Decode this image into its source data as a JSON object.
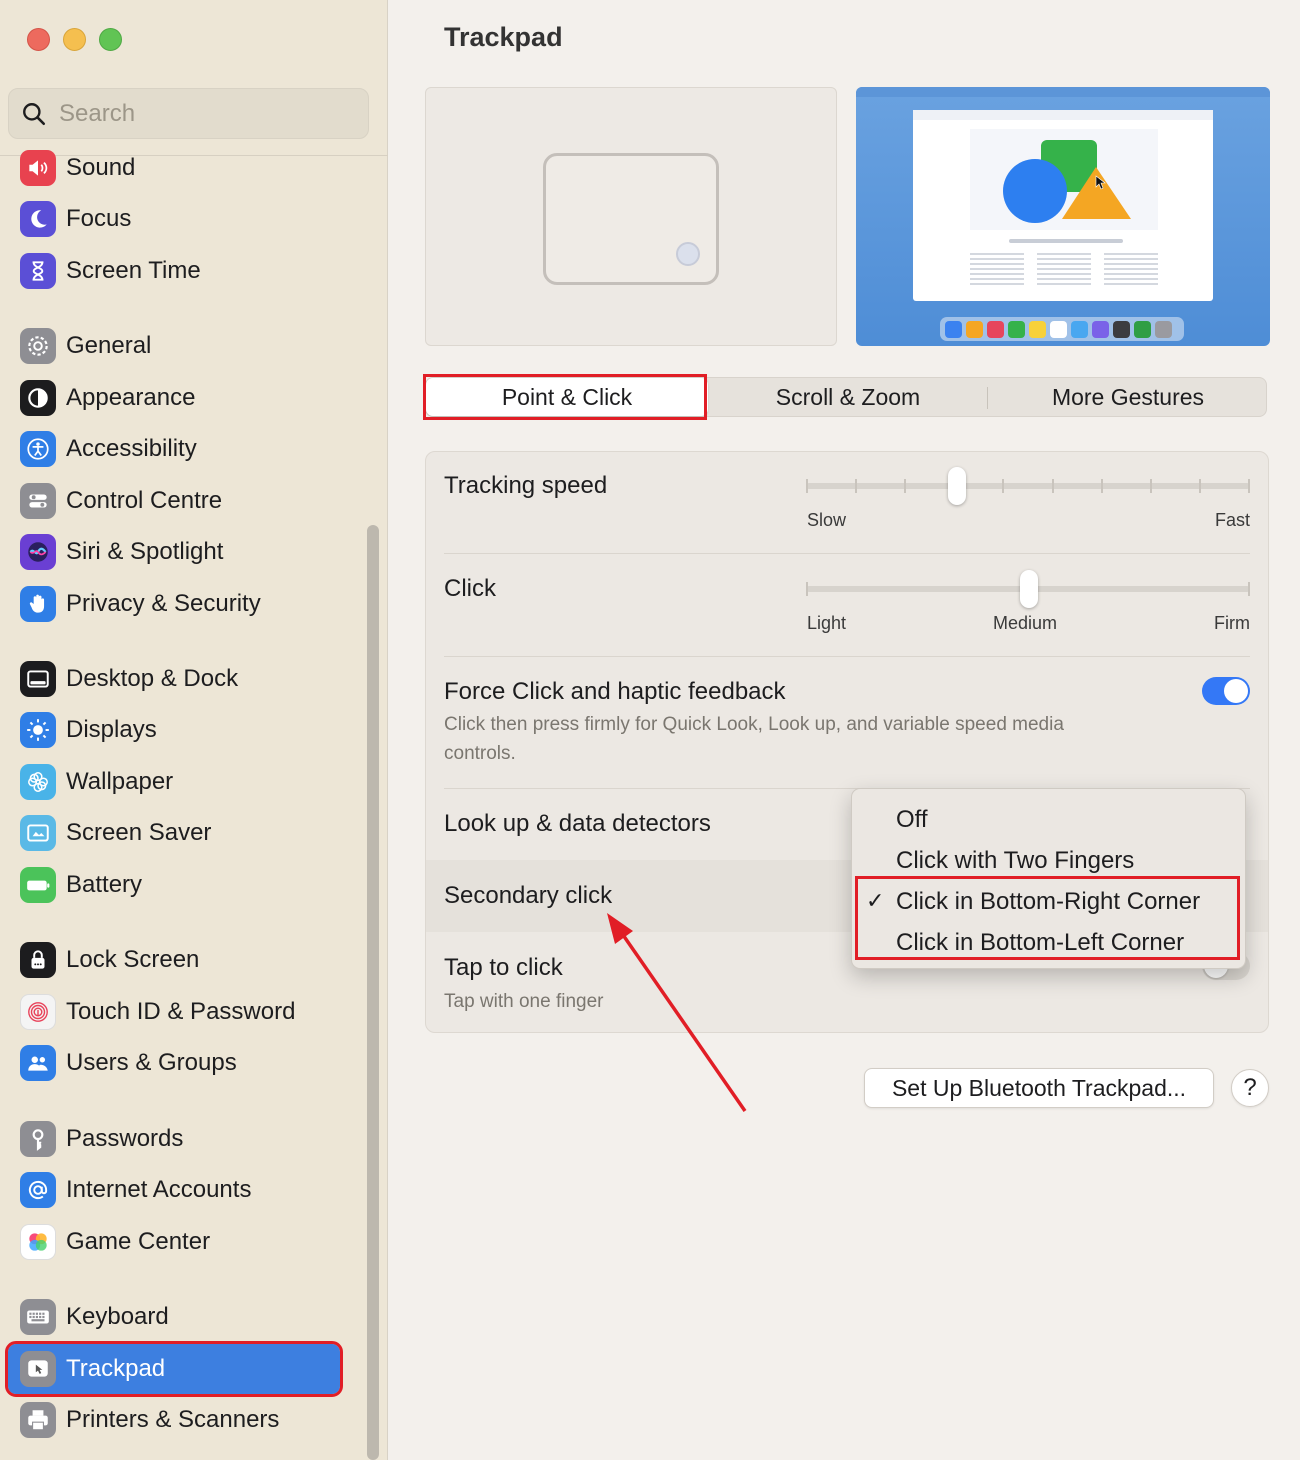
{
  "search": {
    "placeholder": "Search"
  },
  "sidebar": {
    "items": [
      {
        "label": "Sound",
        "icon": "sound-icon",
        "color": "#e8424f"
      },
      {
        "label": "Focus",
        "icon": "moon-icon",
        "color": "#5b4fd6"
      },
      {
        "label": "Screen Time",
        "icon": "hourglass-icon",
        "color": "#5b4fd6"
      },
      {
        "label": "General",
        "icon": "gear-icon",
        "color": "#8e8e93"
      },
      {
        "label": "Appearance",
        "icon": "appearance-icon",
        "color": "#1c1c1e"
      },
      {
        "label": "Accessibility",
        "icon": "accessibility-icon",
        "color": "#2f7ee6"
      },
      {
        "label": "Control Centre",
        "icon": "control-centre-icon",
        "color": "#8e8e93"
      },
      {
        "label": "Siri & Spotlight",
        "icon": "siri-icon",
        "color": "#6a3fd3"
      },
      {
        "label": "Privacy & Security",
        "icon": "hand-icon",
        "color": "#2f7ee6"
      },
      {
        "label": "Desktop & Dock",
        "icon": "dock-icon",
        "color": "#1c1c1e"
      },
      {
        "label": "Displays",
        "icon": "sun-icon",
        "color": "#2f7ee6"
      },
      {
        "label": "Wallpaper",
        "icon": "flower-icon",
        "color": "#49b3e8"
      },
      {
        "label": "Screen Saver",
        "icon": "screen-saver-icon",
        "color": "#5ab9e6"
      },
      {
        "label": "Battery",
        "icon": "battery-icon",
        "color": "#4bc35a"
      },
      {
        "label": "Lock Screen",
        "icon": "lock-icon",
        "color": "#1c1c1e"
      },
      {
        "label": "Touch ID & Password",
        "icon": "fingerprint-icon",
        "color": "#f4f4f4"
      },
      {
        "label": "Users & Groups",
        "icon": "users-icon",
        "color": "#2f7ee6"
      },
      {
        "label": "Passwords",
        "icon": "key-icon",
        "color": "#8e8e93"
      },
      {
        "label": "Internet Accounts",
        "icon": "at-icon",
        "color": "#2f7ee6"
      },
      {
        "label": "Game Center",
        "icon": "game-center-icon",
        "color": "#ffffff"
      },
      {
        "label": "Keyboard",
        "icon": "keyboard-icon",
        "color": "#8e8e93"
      },
      {
        "label": "Trackpad",
        "icon": "trackpad-icon",
        "color": "#8e8e93"
      },
      {
        "label": "Printers & Scanners",
        "icon": "printer-icon",
        "color": "#8e8e93"
      }
    ],
    "selected": "Trackpad"
  },
  "main": {
    "title": "Trackpad",
    "tabs": [
      "Point & Click",
      "Scroll & Zoom",
      "More Gestures"
    ],
    "selected_tab": "Point & Click",
    "tracking_speed": {
      "label": "Tracking speed",
      "min_label": "Slow",
      "max_label": "Fast",
      "value_fraction": 0.34
    },
    "click": {
      "label": "Click",
      "labels": [
        "Light",
        "Medium",
        "Firm"
      ],
      "value": "Medium"
    },
    "force_click": {
      "label": "Force Click and haptic feedback",
      "description": "Click then press firmly for Quick Look, Look up, and variable speed media controls.",
      "enabled": true
    },
    "lookup": {
      "label": "Look up & data detectors"
    },
    "secondary_click": {
      "label": "Secondary click"
    },
    "tap_to_click": {
      "label": "Tap to click",
      "description": "Tap with one finger",
      "enabled": false
    },
    "dropdown": {
      "options": [
        "Off",
        "Click with Two Fingers",
        "Click in Bottom-Right Corner",
        "Click in Bottom-Left Corner"
      ],
      "checked": "Click in Bottom-Right Corner",
      "check_glyph": "✓"
    },
    "bluetooth_button": "Set Up Bluetooth Trackpad...",
    "help_button": "?"
  },
  "colors": {
    "accent": "#3478f6",
    "annotation": "#e11e26"
  }
}
